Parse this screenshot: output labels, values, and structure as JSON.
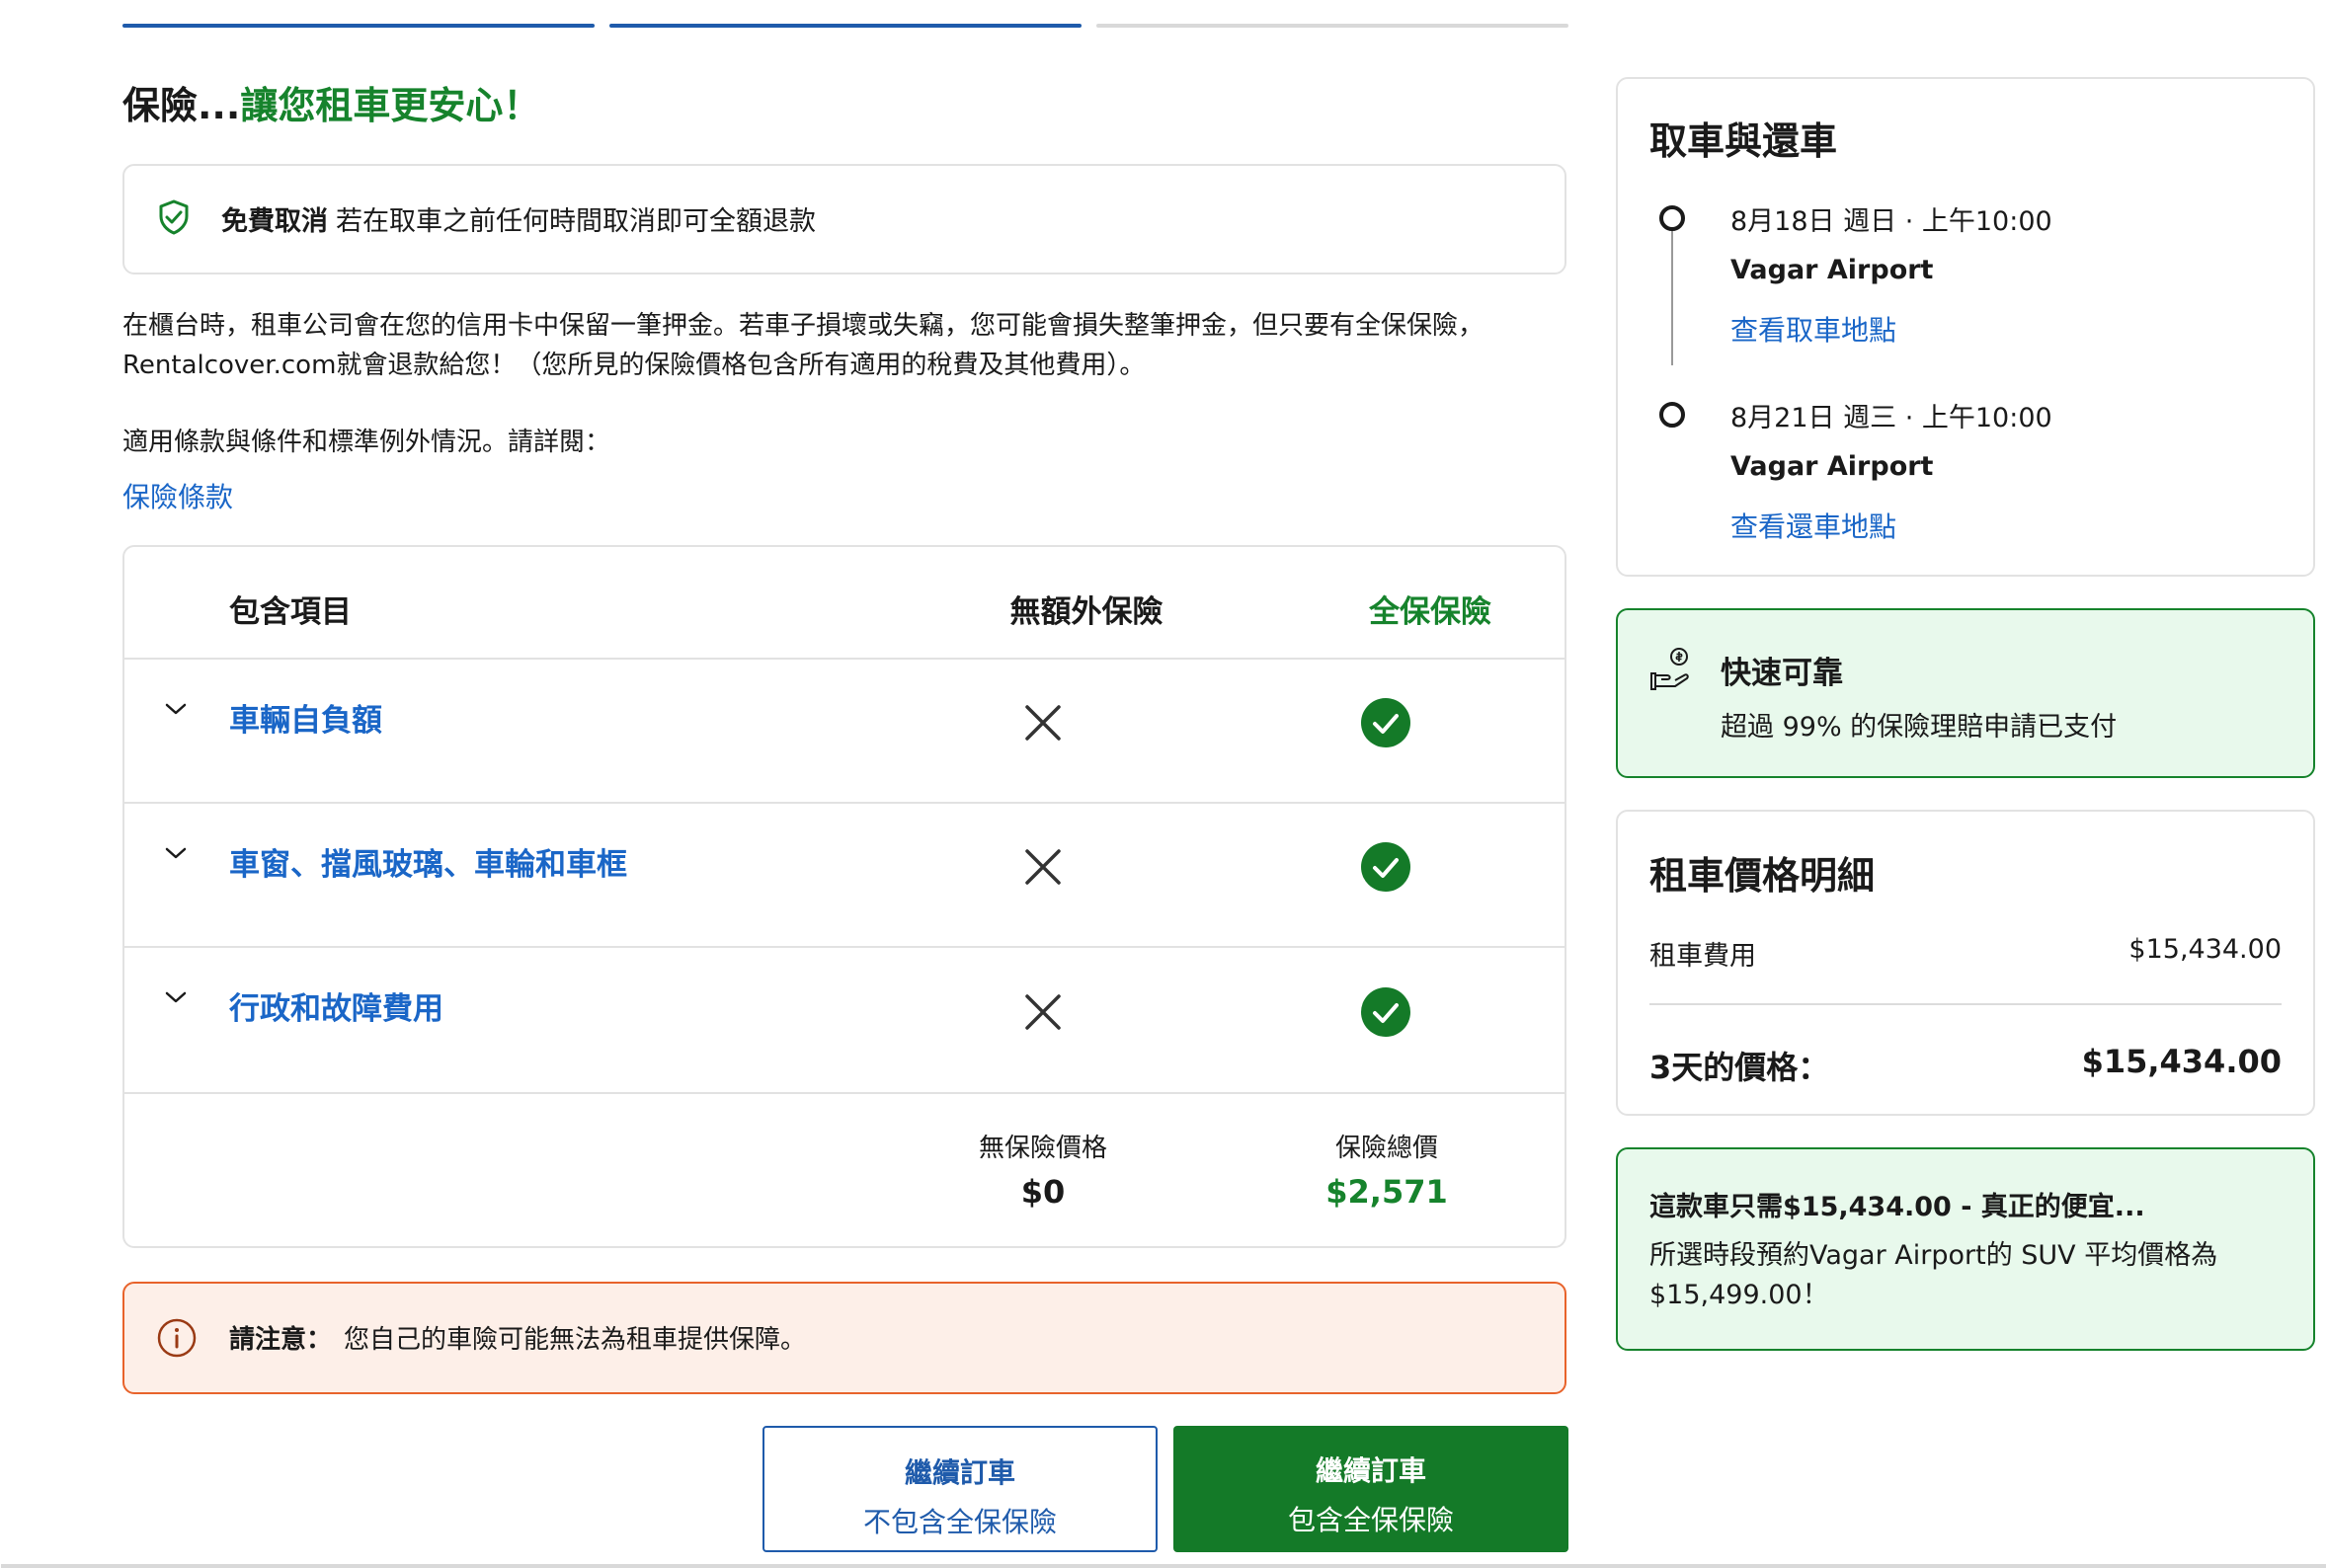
{
  "main": {
    "title_prefix": "保險...",
    "title_highlight": "讓您租車更安心！",
    "free_cancel": {
      "label": "免費取消",
      "text": "若在取車之前任何時間取消即可全額退款"
    },
    "description": "在櫃台時，租車公司會在您的信用卡中保留一筆押金。若車子損壞或失竊，您可能會損失整筆押金，但只要有全保保險，Rentalcover.com就會退款給您！（您所見的保險價格包含所有適用的稅費及其他費用）。",
    "terms_intro": "適用條款與條件和標準例外情況。請詳閱：",
    "terms_link": "保險條款",
    "table": {
      "col_items": "包含項目",
      "col_no_cover": "無額外保險",
      "col_full_cover": "全保保險",
      "rows": [
        {
          "label": "車輛自負額"
        },
        {
          "label": "車窗、擋風玻璃、車輪和車框"
        },
        {
          "label": "行政和故障費用"
        }
      ],
      "no_cover_price_label": "無保險價格",
      "no_cover_price": "$0",
      "full_cover_price_label": "保險總價",
      "full_cover_price": "$2,571"
    },
    "notice": {
      "label": "請注意：",
      "text": "您自己的車險可能無法為租車提供保障。"
    },
    "buttons": {
      "without": {
        "line1": "繼續訂車",
        "line2": "不包含全保保險"
      },
      "with": {
        "line1": "繼續訂車",
        "line2": "包含全保保險"
      }
    }
  },
  "sidebar": {
    "pickup_return": {
      "title": "取車與還車",
      "pickup": {
        "datetime": "8月18日 週日 · 上午10:00",
        "location": "Vagar Airport",
        "link": "查看取車地點"
      },
      "dropoff": {
        "datetime": "8月21日 週三 · 上午10:00",
        "location": "Vagar Airport",
        "link": "查看還車地點"
      }
    },
    "reliable": {
      "title": "快速可靠",
      "text": "超過 99% 的保險理賠申請已支付"
    },
    "price": {
      "title": "租車價格明細",
      "rental_fee_label": "租車費用",
      "rental_fee": "$15,434.00",
      "total_label": "3天的價格：",
      "total": "$15,434.00"
    },
    "deal": {
      "title": "這款車只需$15,434.00 - 真正的便宜...",
      "text": "所選時段預約Vagar Airport的 SUV 平均價格為 $15,499.00！"
    }
  },
  "colors": {
    "brand_blue": "#1f5bab",
    "link_blue": "#1a66c7",
    "green": "#16832c",
    "notice_orange": "#e8632b"
  }
}
